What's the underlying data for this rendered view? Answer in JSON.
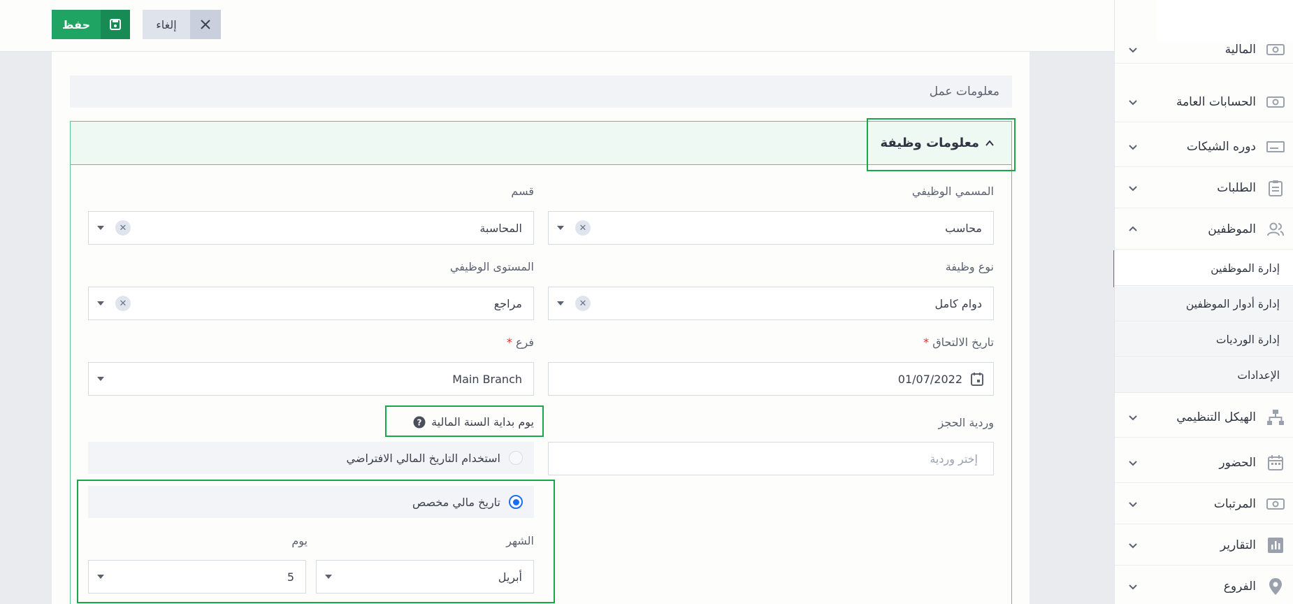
{
  "toolbar": {
    "save_label": "حفظ",
    "cancel_label": "إلغاء"
  },
  "section": {
    "title": "معلومات عمل"
  },
  "panel": {
    "title": "معلومات وظيفة"
  },
  "form": {
    "job_title": {
      "label": "المسمي الوظيفي",
      "value": "محاسب"
    },
    "department": {
      "label": "قسم",
      "value": "المحاسبة"
    },
    "job_type": {
      "label": "نوع وظيفة",
      "value": "دوام كامل"
    },
    "job_level": {
      "label": "المستوى الوظيفي",
      "value": "مراجع"
    },
    "join_date": {
      "label": "تاريخ الالتحاق",
      "required_mark": "*",
      "value": "01/07/2022"
    },
    "branch": {
      "label": "فرع",
      "required_mark": "*",
      "value": "Main Branch"
    },
    "shift": {
      "label": "وردية الحجز",
      "placeholder": "إختر وردية"
    },
    "fiscal_start": {
      "label": "يوم بداية السنة المالية",
      "option_default": "استخدام التاريخ المالي الافتراضي",
      "option_custom": "تاريخ مالي مخصص",
      "selected": "custom",
      "month_label": "الشهر",
      "month_value": "أبريل",
      "day_label": "يوم",
      "day_value": "5"
    }
  },
  "sidebar": {
    "items": [
      {
        "label": "المالية",
        "icon": "money-icon"
      },
      {
        "label": "الحسابات العامة",
        "icon": "money-icon"
      },
      {
        "label": "دوره الشيكات",
        "icon": "cheque-icon"
      },
      {
        "label": "الطلبات",
        "icon": "clipboard-icon"
      },
      {
        "label": "الموظفين",
        "icon": "users-icon"
      },
      {
        "label": "الهيكل التنظيمي",
        "icon": "org-chart-icon"
      },
      {
        "label": "الحضور",
        "icon": "calendar-icon"
      },
      {
        "label": "المرتبات",
        "icon": "money-icon"
      },
      {
        "label": "التقارير",
        "icon": "bar-chart-icon"
      },
      {
        "label": "الفروع",
        "icon": "map-pin-icon"
      }
    ],
    "employee_subitems": [
      "إدارة الموظفين",
      "إدارة أدوار الموظفين",
      "إدارة الورديات",
      "الإعدادات"
    ]
  },
  "colors": {
    "primary_green": "#1fa463",
    "highlight_green": "#1aa64a",
    "radio_blue": "#1b6ef2"
  }
}
